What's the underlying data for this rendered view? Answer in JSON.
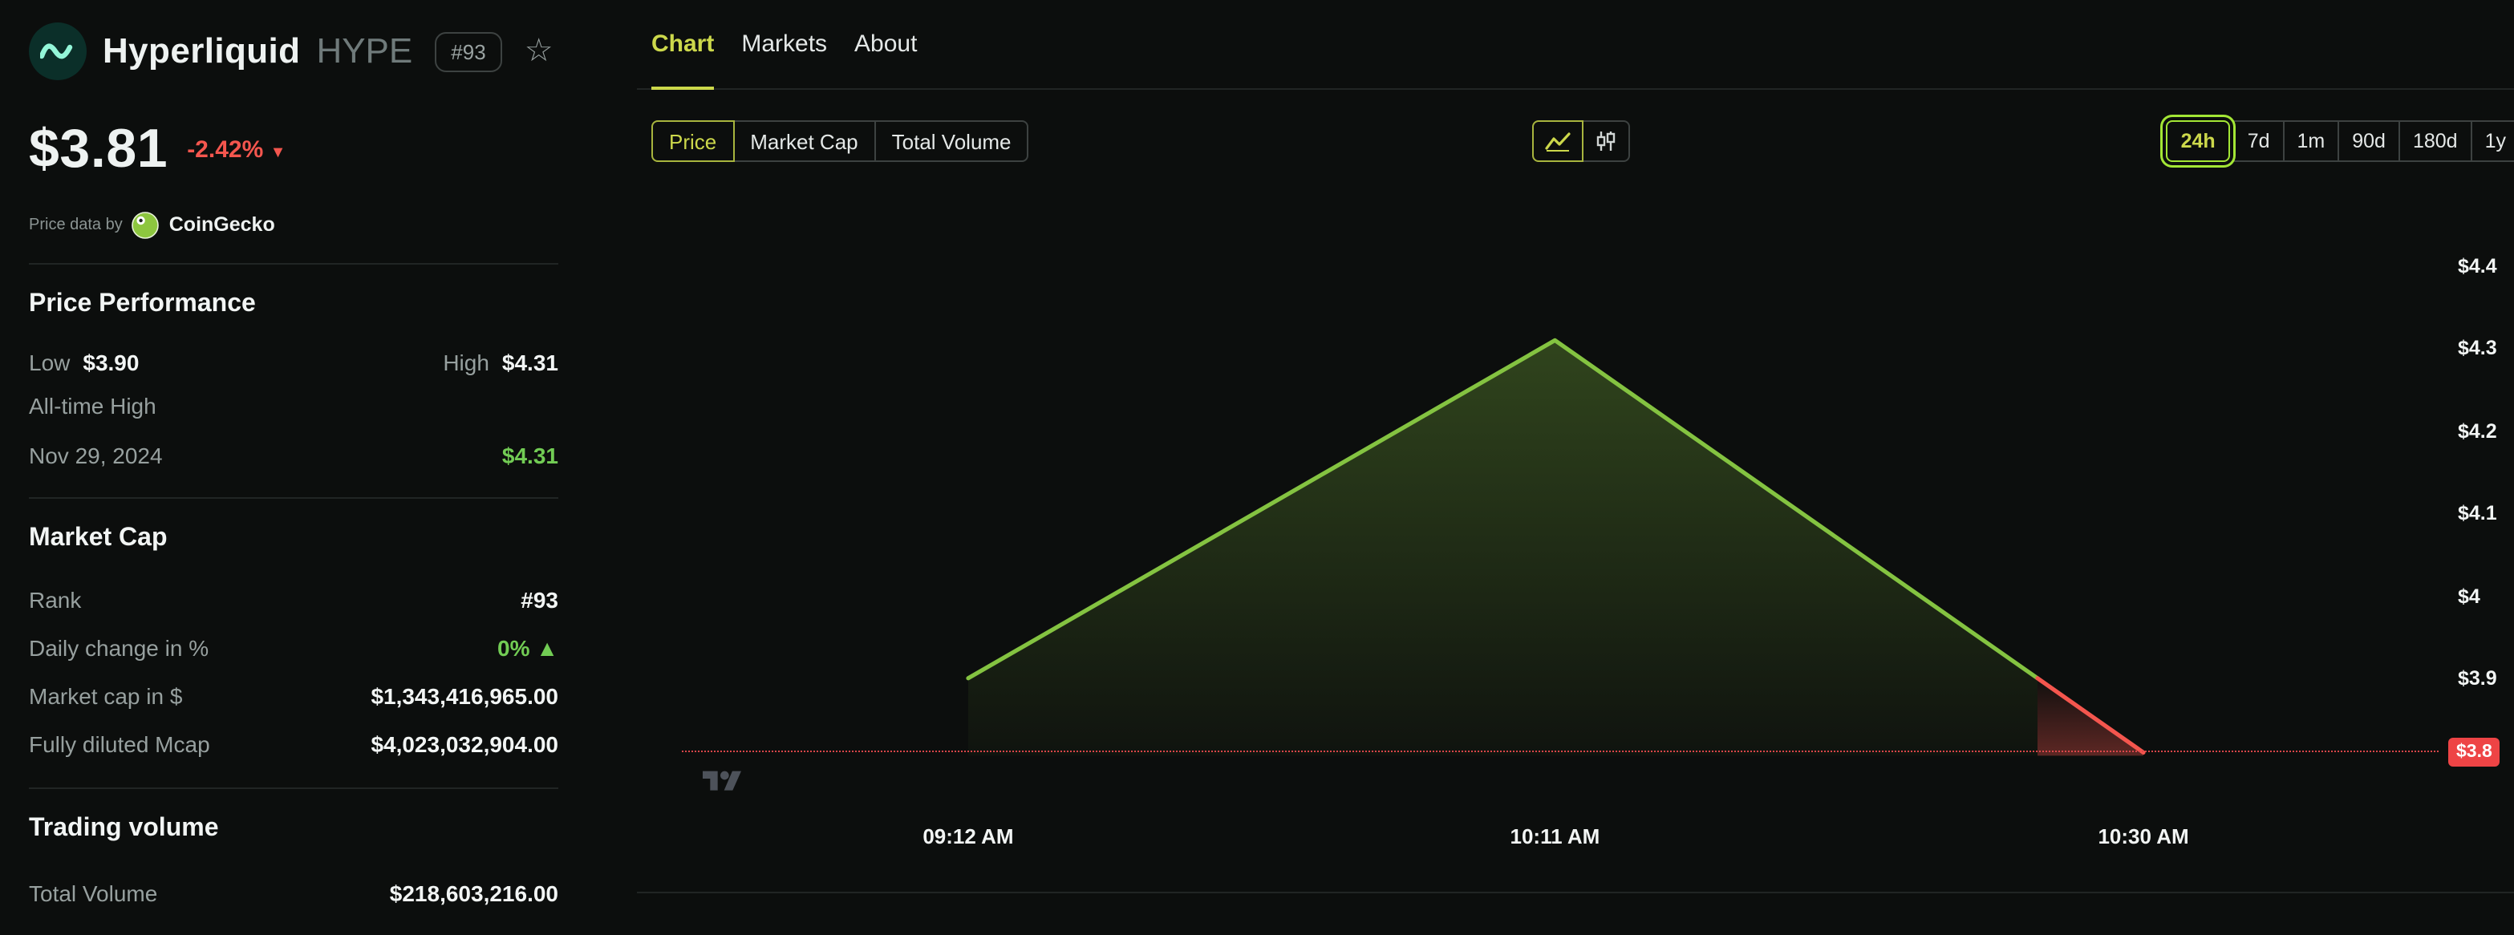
{
  "brand": {
    "logo_icon": "hyperliquid-logo",
    "name": "Hyperliquid",
    "symbol": "HYPE",
    "rank_badge": "#93",
    "favorite_icon": "star-icon"
  },
  "price_header": {
    "price": "$3.81",
    "change": "-2.42%",
    "change_arrow": "▼",
    "attribution_prefix": "Price data by",
    "attribution_brand": "CoinGecko",
    "attribution_icon": "coingecko-logo"
  },
  "sidebar": {
    "price_performance": {
      "title": "Price Performance",
      "low_label": "Low",
      "low_value": "$3.90",
      "high_label": "High",
      "high_value": "$4.31",
      "ath_label": "All-time High",
      "ath_date": "Nov 29, 2024",
      "ath_value": "$4.31"
    },
    "market_cap": {
      "title": "Market Cap",
      "rows": [
        {
          "label": "Rank",
          "value": "#93"
        },
        {
          "label": "Daily change in %",
          "value": "0% ▲"
        },
        {
          "label": "Market cap in $",
          "value": "$1,343,416,965.00"
        },
        {
          "label": "Fully diluted Mcap",
          "value": "$4,023,032,904.00"
        }
      ]
    },
    "trading_volume": {
      "title": "Trading volume",
      "rows": [
        {
          "label": "Total Volume",
          "value": "$218,603,216.00"
        }
      ]
    }
  },
  "main": {
    "tabs": [
      {
        "label": "Chart",
        "active": true
      },
      {
        "label": "Markets",
        "active": false
      },
      {
        "label": "About",
        "active": false
      }
    ],
    "metric_toggle": {
      "options": [
        "Price",
        "Market Cap",
        "Total Volume"
      ],
      "active": "Price"
    },
    "chart_type_toggle": {
      "options": [
        "line-chart-icon",
        "candlestick-icon"
      ],
      "active": "line-chart-icon"
    },
    "range_toggle": {
      "options": [
        "24h",
        "7d",
        "1m",
        "90d",
        "180d",
        "1y"
      ],
      "active": "24h"
    },
    "watermark_icon": "tradingview-logo"
  },
  "chart_data": {
    "type": "line",
    "x_label": "time",
    "y_label": "price_usd",
    "points": [
      {
        "x": "09:12 AM",
        "y": 3.9
      },
      {
        "x": "10:11 AM",
        "y": 4.31
      },
      {
        "x": "10:30 AM",
        "y": 3.81
      }
    ],
    "x_tick_labels": [
      "09:12 AM",
      "10:11 AM",
      "10:30 AM"
    ],
    "y_ticks": [
      {
        "label": "$4.4",
        "value": 4.4
      },
      {
        "label": "$4.3",
        "value": 4.3
      },
      {
        "label": "$4.2",
        "value": 4.2
      },
      {
        "label": "$4.1",
        "value": 4.1
      },
      {
        "label": "$4",
        "value": 4.0
      },
      {
        "label": "$3.9",
        "value": 3.9
      }
    ],
    "current_price": 3.81,
    "current_price_label": "$3.8",
    "red_below": 3.9,
    "ylim": [
      3.75,
      4.47
    ],
    "grid": false,
    "legend": false,
    "colors": {
      "line_up": "#84c341",
      "line_down": "#f4564e",
      "current_line": "#e5484d",
      "current_badge_bg": "#ee4445"
    }
  },
  "colors": {
    "background": "#0c0e0d",
    "accent": "#ccd84b",
    "highlight_ring": "#a3e635",
    "positive": "#72cc54",
    "negative": "#f4564e",
    "text_primary": "#eef2f1",
    "text_secondary": "#97a09f"
  }
}
